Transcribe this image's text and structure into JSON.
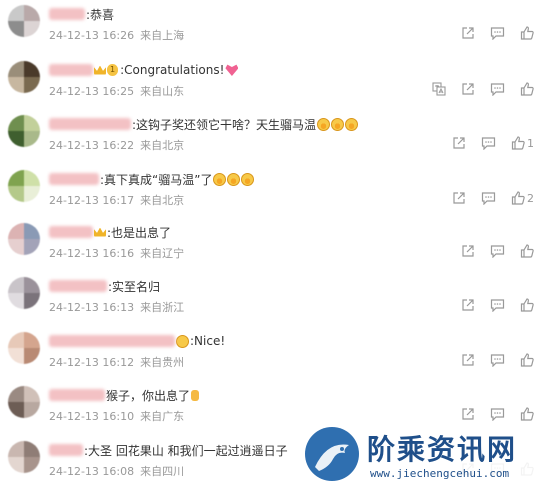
{
  "comments": [
    {
      "text": ":恭喜",
      "emojis": [],
      "time": "24-12-13 16:26",
      "location": "来自上海",
      "likes": "",
      "translate": false,
      "blur_width": 36,
      "avatar_colors": [
        "#c9c9c9",
        "#b9a9a9",
        "#8d8d8d",
        "#dcd4d4"
      ]
    },
    {
      "text": ":Congratulations!",
      "emojis": [
        "heart"
      ],
      "badge": "1",
      "time": "24-12-13 16:25",
      "location": "来自山东",
      "likes": "",
      "translate": true,
      "blur_width": 44,
      "avatar_colors": [
        "#9a8e7a",
        "#4a3a2a",
        "#c7b7a0",
        "#7a6a50"
      ]
    },
    {
      "text": ":这钩子奖还领它干啥？天生骝马温",
      "emojis": [
        "laugh",
        "laugh",
        "laugh"
      ],
      "time": "24-12-13 16:22",
      "location": "来自北京",
      "likes": "1",
      "translate": false,
      "blur_width": 82,
      "avatar_colors": [
        "#6f8f4f",
        "#c2d09a",
        "#3f5f2f",
        "#a9b98a"
      ]
    },
    {
      "text": ":真下真成“骝马温”了",
      "emojis": [
        "laugh",
        "laugh",
        "laugh"
      ],
      "time": "24-12-13 16:17",
      "location": "来自北京",
      "likes": "2",
      "translate": false,
      "blur_width": 50,
      "avatar_colors": [
        "#7fa34f",
        "#cfe0a8",
        "#b4c98a",
        "#e9efd8"
      ]
    },
    {
      "text": ":也是出息了",
      "emojis": [],
      "prefix_emoji": "crown",
      "time": "24-12-13 16:16",
      "location": "来自辽宁",
      "likes": "",
      "translate": false,
      "blur_width": 44,
      "avatar_colors": [
        "#dcb3b3",
        "#8a9ab5",
        "#e6cfcf",
        "#a3a3b8"
      ]
    },
    {
      "text": ":实至名归",
      "emojis": [],
      "time": "24-12-13 16:13",
      "location": "来自浙江",
      "likes": "",
      "translate": false,
      "blur_width": 58,
      "avatar_colors": [
        "#c9c4c9",
        "#9b929b",
        "#e0dce0",
        "#7b737b"
      ]
    },
    {
      "text": ":Nice!",
      "emojis": [],
      "prefix_emoji": "sunglass",
      "time": "24-12-13 16:12",
      "location": "来自贵州",
      "likes": "",
      "translate": false,
      "blur_width": 126,
      "avatar_colors": [
        "#e7c9b8",
        "#d4a58e",
        "#f2e0d6",
        "#b98a74"
      ]
    },
    {
      "text": "猴子，你出息了",
      "emojis": [
        "thumb"
      ],
      "time": "24-12-13 16:10",
      "location": "来自广东",
      "likes": "",
      "translate": false,
      "blur_width": 56,
      "avatar_colors": [
        "#9a8a82",
        "#d0c0b8",
        "#6d5d55",
        "#b8a8a0"
      ]
    },
    {
      "text": ":大圣 回花果山 和我们一起过逍遥日子",
      "emojis": [],
      "time": "24-12-13 16:08",
      "location": "来自四川",
      "likes": "",
      "translate": false,
      "blur_width": 34,
      "avatar_colors": [
        "#c9b7b0",
        "#8f7d76",
        "#e3d6d0",
        "#a8948c"
      ]
    }
  ],
  "watermark": {
    "title": "阶乘资讯网",
    "url": "www.jiechengcehui.com"
  }
}
